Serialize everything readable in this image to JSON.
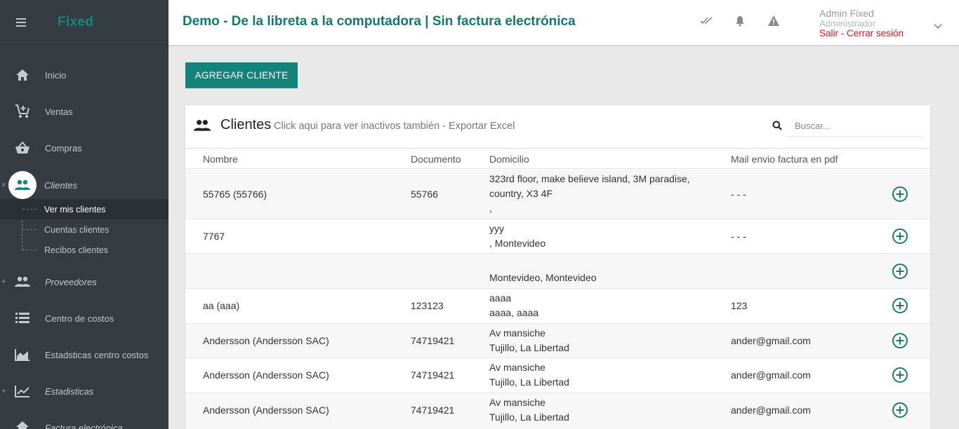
{
  "sidebar": {
    "brand": "Fixed",
    "nav": [
      {
        "label": "Inicio",
        "icon": "home-icon"
      },
      {
        "label": "Ventas",
        "icon": "cart-plus-icon"
      },
      {
        "label": "Compras",
        "icon": "basket-icon"
      },
      {
        "label": "Clientes",
        "icon": "people-icon"
      },
      {
        "label": "Proveedores",
        "icon": "people-icon"
      },
      {
        "label": "Centro de costos",
        "icon": "list-icon"
      },
      {
        "label": "Estadsticas centro costos",
        "icon": "area-chart-icon"
      },
      {
        "label": "Estadisticas",
        "icon": "line-chart-icon"
      },
      {
        "label": "Factura electrónica",
        "icon": "invoice-icon"
      }
    ],
    "clientes_sub": [
      {
        "label": "Ver mis clientes",
        "selected": true
      },
      {
        "label": "Cuentas clientes"
      },
      {
        "label": "Recibos clientes"
      }
    ],
    "collapse_mark": "×",
    "expand_mark": "+"
  },
  "header": {
    "title": "Demo - De la libreta a la computadora | Sin factura electrónica",
    "user_name": "Admin Fixed",
    "user_role": "Administrador",
    "logout": "Salir - Cerrar sesión"
  },
  "add_button": "AGREGAR CLIENTE",
  "card": {
    "title": "Clientes",
    "subtitle": "Click aqui para ver inactivos también - Exportar Excel",
    "search_placeholder": "Buscar..."
  },
  "table": {
    "columns": [
      "Nombre",
      "Documento",
      "Domicilio",
      "Mail envio factura en pdf"
    ],
    "rows": [
      {
        "name": "55765 (55766)",
        "doc": "55766",
        "dom1": "323rd floor, make believe island, 3M paradise,",
        "dom2": "country, X3 4F",
        "dom3": ",",
        "mail": "- - -"
      },
      {
        "name": "7767",
        "doc": "",
        "dom1": "yyy",
        "dom2": ", Montevideo",
        "dom3": "",
        "mail": "- - -"
      },
      {
        "name": "",
        "doc": "",
        "dom1": "",
        "dom2": "Montevideo, Montevideo",
        "dom3": "",
        "mail": ""
      },
      {
        "name": "aa (aaa)",
        "doc": "123123",
        "dom1": "aaaa",
        "dom2": "aaaa, aaaa",
        "dom3": "",
        "mail": "123"
      },
      {
        "name": "Andersson (Andersson SAC)",
        "doc": "74719421",
        "dom1": "Av mansiche",
        "dom2": "Tujillo, La Libertad",
        "dom3": "",
        "mail": "ander@gmail.com"
      },
      {
        "name": "Andersson (Andersson SAC)",
        "doc": "74719421",
        "dom1": "Av mansiche",
        "dom2": "Tujillo, La Libertad",
        "dom3": "",
        "mail": "ander@gmail.com"
      },
      {
        "name": "Andersson (Andersson SAC)",
        "doc": "74719421",
        "dom1": "Av mansiche",
        "dom2": "Tujillo, La Libertad",
        "dom3": "",
        "mail": "ander@gmail.com"
      }
    ]
  },
  "colors": {
    "accent": "#148379",
    "sidebar_bg": "#353c42",
    "logout": "#d9141e"
  }
}
